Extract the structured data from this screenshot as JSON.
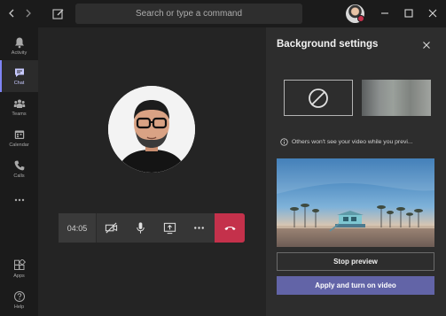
{
  "titlebar": {
    "back_icon": "chevron-left-icon",
    "forward_icon": "chevron-right-icon",
    "compose_icon": "compose-icon",
    "search_placeholder": "Search or type a command",
    "window_controls": [
      "minimize-icon",
      "maximize-icon",
      "close-icon"
    ],
    "presence_status_color": "#c4314b"
  },
  "rail": {
    "items": [
      {
        "label": "Activity",
        "icon": "bell-icon",
        "active": false
      },
      {
        "label": "Chat",
        "icon": "chat-icon",
        "active": true
      },
      {
        "label": "Teams",
        "icon": "teams-icon",
        "active": false
      },
      {
        "label": "Calendar",
        "icon": "calendar-icon",
        "active": false
      },
      {
        "label": "Calls",
        "icon": "phone-icon",
        "active": false
      }
    ],
    "more_icon": "ellipsis-icon",
    "bottom": [
      {
        "label": "Apps",
        "icon": "apps-icon"
      },
      {
        "label": "Help",
        "icon": "help-icon"
      }
    ]
  },
  "call": {
    "timer": "04:05",
    "controls": [
      "camera-off-icon",
      "microphone-icon",
      "share-screen-icon",
      "more-options-icon"
    ],
    "hangup_icon": "hang-up-icon",
    "hangup_color": "#c4314b"
  },
  "panel": {
    "title": "Background settings",
    "info_text": "Others won't see your video while you previ...",
    "stop_label": "Stop preview",
    "apply_label": "Apply and turn on video",
    "accent": "#6264a7"
  }
}
